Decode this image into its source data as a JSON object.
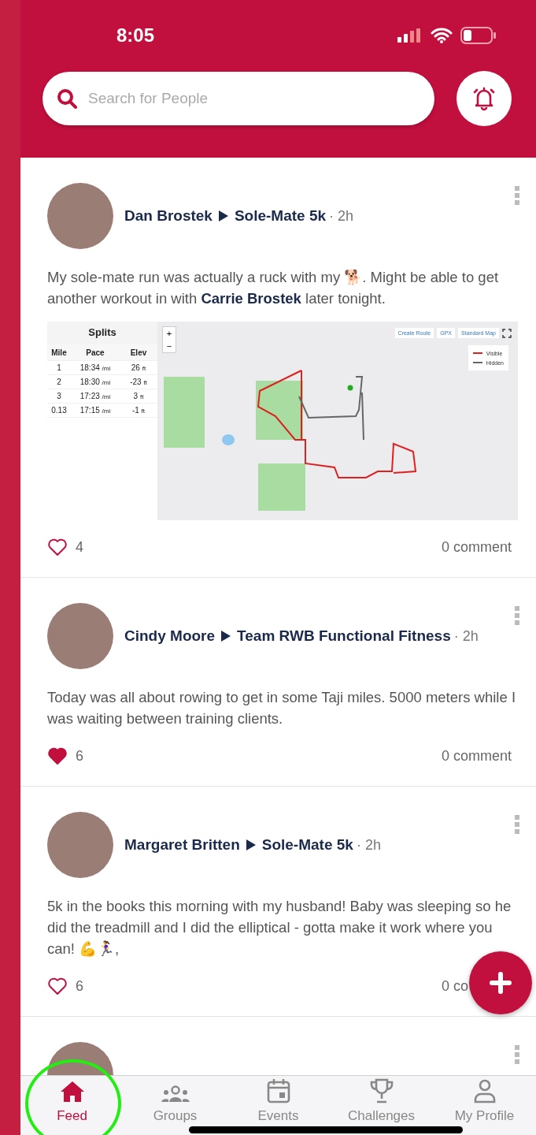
{
  "status_bar": {
    "time": "8:05"
  },
  "search": {
    "placeholder": "Search for People"
  },
  "posts": [
    {
      "author": "Dan Brostek",
      "group": "Sole-Mate 5k",
      "time": "· 2h",
      "text": "My sole-mate run was actually a ruck with my 🐕. Might be able to get another workout in with **Carrie Brostek** later tonight.",
      "liked": false,
      "likes": "4",
      "comments": "0 comment",
      "attachment": {
        "splits": {
          "title": "Splits",
          "columns": [
            "Mile",
            "Pace",
            "Elev"
          ],
          "rows": [
            {
              "mile": "1",
              "pace": "18:34",
              "pace_unit": "/mi",
              "elev": "26",
              "elev_unit": "ft"
            },
            {
              "mile": "2",
              "pace": "18:30",
              "pace_unit": "/mi",
              "elev": "-23",
              "elev_unit": "ft"
            },
            {
              "mile": "3",
              "pace": "17:23",
              "pace_unit": "/mi",
              "elev": "3",
              "elev_unit": "ft"
            },
            {
              "mile": "0.13",
              "pace": "17:15",
              "pace_unit": "/mi",
              "elev": "-1",
              "elev_unit": "ft"
            }
          ]
        },
        "map": {
          "zoom_in": "+",
          "zoom_out": "−",
          "actions": [
            "Create Route",
            "GPX",
            "Standard Map"
          ],
          "legend": [
            {
              "label": "Visible",
              "color": "#e02020"
            },
            {
              "label": "Hidden",
              "color": "#666666"
            }
          ]
        }
      }
    },
    {
      "author": "Cindy Moore",
      "group": "Team RWB Functional Fitness",
      "time": "· 2h",
      "text": "Today was all about rowing to get in some Taji miles. 5000 meters while I was waiting between training clients.",
      "liked": true,
      "likes": "6",
      "comments": "0 comment"
    },
    {
      "author": "Margaret Britten",
      "group": "Sole-Mate 5k",
      "time": "· 2h",
      "text": "5k in the books this morning with my husband! Baby was sleeping so he did the treadmill and I did the elliptical - gotta make it work where you can! 💪🏃‍♀️,",
      "liked": false,
      "likes": "6",
      "comments": "0 co"
    }
  ],
  "nav": [
    {
      "label": "Feed",
      "kind": "home",
      "selected": true
    },
    {
      "label": "Groups",
      "kind": "groups",
      "selected": false
    },
    {
      "label": "Events",
      "kind": "calendar",
      "selected": false
    },
    {
      "label": "Challenges",
      "kind": "trophy",
      "selected": false
    },
    {
      "label": "My Profile",
      "kind": "person",
      "selected": false
    }
  ]
}
